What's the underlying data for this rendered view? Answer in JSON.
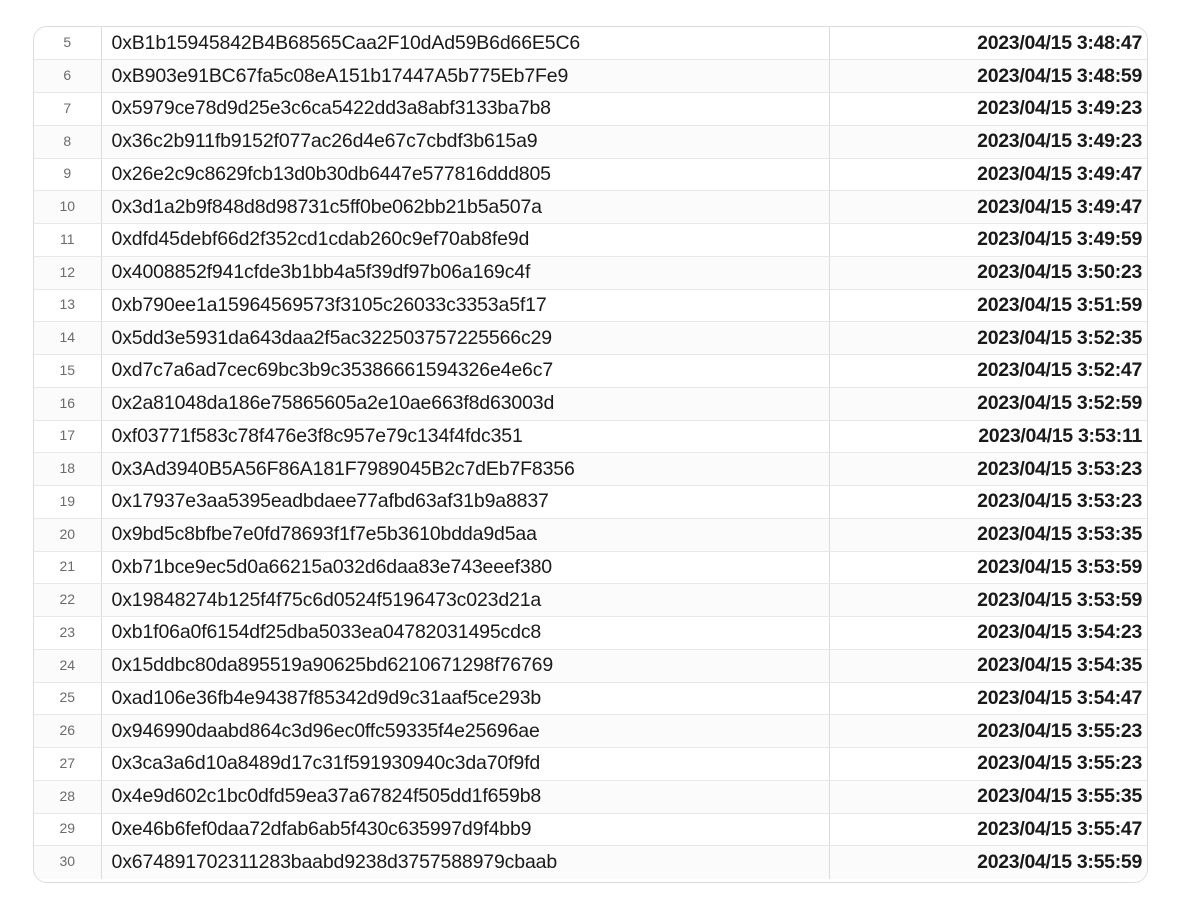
{
  "table": {
    "columns": [
      "row_number",
      "address",
      "timestamp"
    ],
    "rows": [
      {
        "n": "5",
        "address": "0xB1b15945842B4B68565Caa2F10dAd59B6d66E5C6",
        "timestamp": "2023/04/15 3:48:47"
      },
      {
        "n": "6",
        "address": "0xB903e91BC67fa5c08eA151b17447A5b775Eb7Fe9",
        "timestamp": "2023/04/15 3:48:59"
      },
      {
        "n": "7",
        "address": "0x5979ce78d9d25e3c6ca5422dd3a8abf3133ba7b8",
        "timestamp": "2023/04/15 3:49:23"
      },
      {
        "n": "8",
        "address": "0x36c2b911fb9152f077ac26d4e67c7cbdf3b615a9",
        "timestamp": "2023/04/15 3:49:23"
      },
      {
        "n": "9",
        "address": "0x26e2c9c8629fcb13d0b30db6447e577816ddd805",
        "timestamp": "2023/04/15 3:49:47"
      },
      {
        "n": "10",
        "address": "0x3d1a2b9f848d8d98731c5ff0be062bb21b5a507a",
        "timestamp": "2023/04/15 3:49:47"
      },
      {
        "n": "11",
        "address": "0xdfd45debf66d2f352cd1cdab260c9ef70ab8fe9d",
        "timestamp": "2023/04/15 3:49:59"
      },
      {
        "n": "12",
        "address": "0x4008852f941cfde3b1bb4a5f39df97b06a169c4f",
        "timestamp": "2023/04/15 3:50:23"
      },
      {
        "n": "13",
        "address": "0xb790ee1a15964569573f3105c26033c3353a5f17",
        "timestamp": "2023/04/15 3:51:59"
      },
      {
        "n": "14",
        "address": "0x5dd3e5931da643daa2f5ac322503757225566c29",
        "timestamp": "2023/04/15 3:52:35"
      },
      {
        "n": "15",
        "address": "0xd7c7a6ad7cec69bc3b9c35386661594326e4e6c7",
        "timestamp": "2023/04/15 3:52:47"
      },
      {
        "n": "16",
        "address": "0x2a81048da186e75865605a2e10ae663f8d63003d",
        "timestamp": "2023/04/15 3:52:59"
      },
      {
        "n": "17",
        "address": "0xf03771f583c78f476e3f8c957e79c134f4fdc351",
        "timestamp": "2023/04/15 3:53:11"
      },
      {
        "n": "18",
        "address": "0x3Ad3940B5A56F86A181F7989045B2c7dEb7F8356",
        "timestamp": "2023/04/15 3:53:23"
      },
      {
        "n": "19",
        "address": "0x17937e3aa5395eadbdaee77afbd63af31b9a8837",
        "timestamp": "2023/04/15 3:53:23"
      },
      {
        "n": "20",
        "address": "0x9bd5c8bfbe7e0fd78693f1f7e5b3610bdda9d5aa",
        "timestamp": "2023/04/15 3:53:35"
      },
      {
        "n": "21",
        "address": "0xb71bce9ec5d0a66215a032d6daa83e743eeef380",
        "timestamp": "2023/04/15 3:53:59"
      },
      {
        "n": "22",
        "address": "0x19848274b125f4f75c6d0524f5196473c023d21a",
        "timestamp": "2023/04/15 3:53:59"
      },
      {
        "n": "23",
        "address": "0xb1f06a0f6154df25dba5033ea04782031495cdc8",
        "timestamp": "2023/04/15 3:54:23"
      },
      {
        "n": "24",
        "address": "0x15ddbc80da895519a90625bd6210671298f76769",
        "timestamp": "2023/04/15 3:54:35"
      },
      {
        "n": "25",
        "address": "0xad106e36fb4e94387f85342d9d9c31aaf5ce293b",
        "timestamp": "2023/04/15 3:54:47"
      },
      {
        "n": "26",
        "address": "0x946990daabd864c3d96ec0ffc59335f4e25696ae",
        "timestamp": "2023/04/15 3:55:23"
      },
      {
        "n": "27",
        "address": "0x3ca3a6d10a8489d17c31f591930940c3da70f9fd",
        "timestamp": "2023/04/15 3:55:23"
      },
      {
        "n": "28",
        "address": "0x4e9d602c1bc0dfd59ea37a67824f505dd1f659b8",
        "timestamp": "2023/04/15 3:55:35"
      },
      {
        "n": "29",
        "address": "0xe46b6fef0daa72dfab6ab5f430c635997d9f4bb9",
        "timestamp": "2023/04/15 3:55:47"
      },
      {
        "n": "30",
        "address": "0x674891702311283baabd9238d3757588979cbaab",
        "timestamp": "2023/04/15 3:55:59"
      }
    ]
  },
  "colors": {
    "page_background": "#ffffff",
    "card_border": "#dcdcdc",
    "row_divider": "#e8e8e8",
    "row_stripe": "#fbfbfb",
    "text": "#1a1a1a",
    "rownum_text": "#6b6b6b"
  }
}
